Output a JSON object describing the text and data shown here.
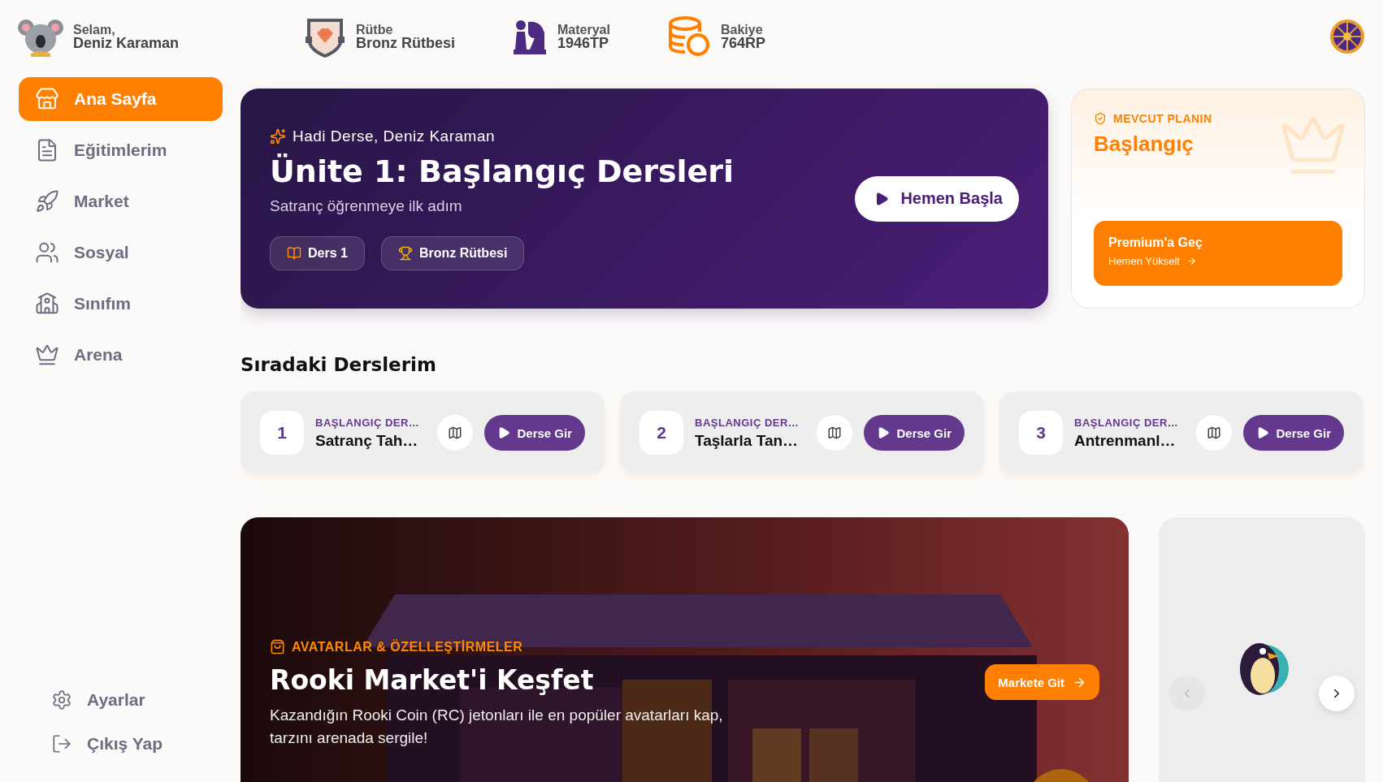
{
  "user": {
    "greeting": "Selam,",
    "name": "Deniz Karaman"
  },
  "stats": [
    {
      "label": "Rütbe",
      "value": "Bronz Rütbesi"
    },
    {
      "label": "Materyal",
      "value": "1946TP"
    },
    {
      "label": "Bakiye",
      "value": "764RP"
    }
  ],
  "nav": [
    {
      "label": "Ana Sayfa",
      "selected": true
    },
    {
      "label": "Eğitimlerim",
      "selected": false
    },
    {
      "label": "Market",
      "selected": false
    },
    {
      "label": "Sosyal",
      "selected": false
    },
    {
      "label": "Sınıfım",
      "selected": false
    },
    {
      "label": "Arena",
      "selected": false
    }
  ],
  "bottom_nav": [
    "Ayarlar",
    "Çıkış Yap"
  ],
  "hero": {
    "eyebrow": "Hadi Derse, Deniz Karaman",
    "title": "Ünite 1: Başlangıç Dersleri",
    "subtitle": "Satranç öğrenmeye ilk adım",
    "chips": [
      "Ders 1",
      "Bronz Rütbesi"
    ],
    "button": "Hemen Başla"
  },
  "plan": {
    "label": "MEVCUT PLANIN",
    "name": "Başlangıç",
    "cta_title": "Premium'a Geç",
    "cta_sub": "Hemen Yükselt"
  },
  "lessons_title": "Sıradaki Derslerim",
  "lessons": [
    {
      "number": "1",
      "category": "BAŞLANGIÇ DER…",
      "title": "Satranç Tah…",
      "button": "Derse Gir"
    },
    {
      "number": "2",
      "category": "BAŞLANGIÇ DER…",
      "title": "Taşlarla Tan…",
      "button": "Derse Gir"
    },
    {
      "number": "3",
      "category": "BAŞLANGIÇ DER…",
      "title": "Antrenmanl…",
      "button": "Derse Gir"
    }
  ],
  "market": {
    "kind": "picture",
    "eyebrow": "AVATARLAR & ÖZELLEŞTİRMELER",
    "title": "Rooki Market'i Keşfet",
    "text": "Kazandığın Rooki Coin (RC) jetonları ile en popüler avatarları kap, tarzını arenada sergile!",
    "button": "Markete Git"
  },
  "carousel": {
    "prev_disabled": true,
    "next_disabled": false
  }
}
